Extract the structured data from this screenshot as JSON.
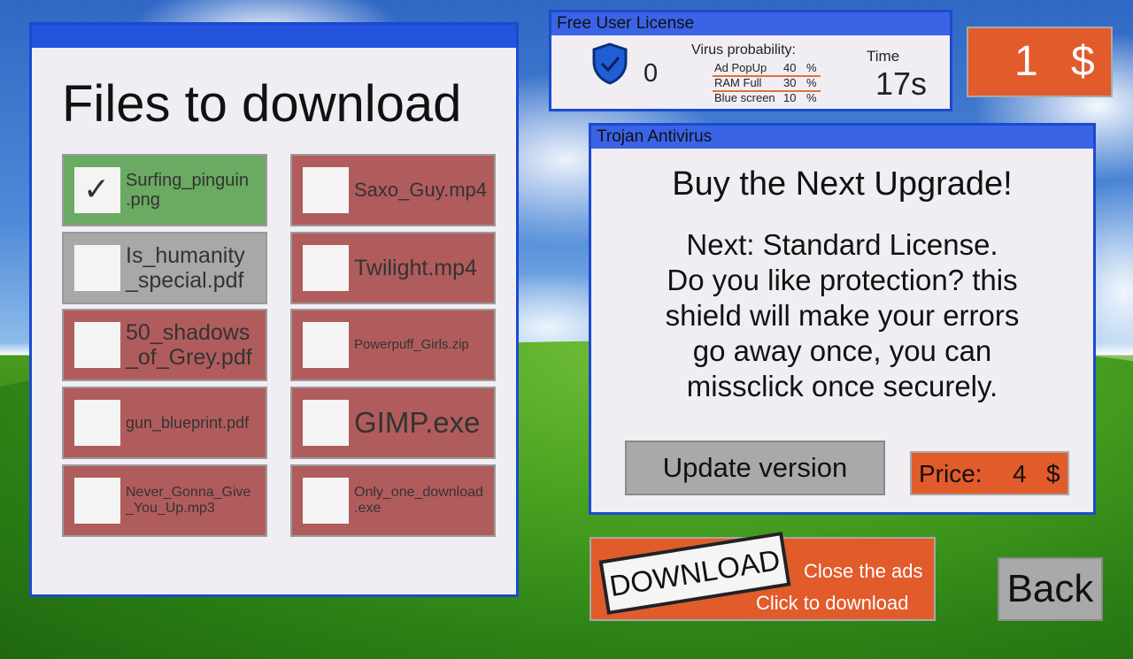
{
  "files_window": {
    "title": "Files to download",
    "files": [
      {
        "name": "Surfing_pinguin\n.png",
        "checked": true,
        "color": "#6aaa62"
      },
      {
        "name": "Saxo_Guy.mp4",
        "checked": false,
        "color": "#b15c5c"
      },
      {
        "name": "Is_humanity\n_special.pdf",
        "checked": false,
        "color": "#a8a8a8"
      },
      {
        "name": "Twilight.mp4",
        "checked": false,
        "color": "#b15c5c"
      },
      {
        "name": "50_shadows\n_of_Grey.pdf",
        "checked": false,
        "color": "#b15c5c"
      },
      {
        "name": "Powerpuff_Girls.zip",
        "checked": false,
        "color": "#b15c5c"
      },
      {
        "name": "gun_blueprint.pdf",
        "checked": false,
        "color": "#b15c5c"
      },
      {
        "name": "GIMP.exe",
        "checked": false,
        "color": "#b15c5c"
      },
      {
        "name": "Never_Gonna_Give\n_You_Up.mp3",
        "checked": false,
        "color": "#b15c5c"
      },
      {
        "name": "Only_one_download\n.exe",
        "checked": false,
        "color": "#b15c5c"
      }
    ],
    "check_mark": "✓"
  },
  "license": {
    "title": "Free User License",
    "shield_icon": "shield-check-icon",
    "shield_count": "0",
    "virus_title": "Virus probability:",
    "virus_rows": [
      {
        "label": "Ad PopUp",
        "value": "40",
        "unit": "%"
      },
      {
        "label": "RAM Full",
        "value": "30",
        "unit": "%"
      },
      {
        "label": "Blue screen",
        "value": "10",
        "unit": "%"
      }
    ],
    "time_label": "Time",
    "time_value": "17s"
  },
  "money": {
    "amount": "1",
    "currency": "$"
  },
  "antivirus": {
    "title": "Trojan Antivirus",
    "heading": "Buy the Next Upgrade!",
    "description": "Next: Standard License.\nDo you like protection? this\nshield will make your errors\ngo away once, you can\nmissclick once securely.",
    "update_button": "Update version",
    "price_label": "Price:",
    "price_value": "4",
    "price_currency": "$"
  },
  "download": {
    "badge": "DOWNLOAD",
    "close_text": "Close the ads",
    "click_text": "Click to download"
  },
  "back_button": "Back",
  "colors": {
    "accent_orange": "#e25b2b",
    "title_blue": "#2453dd",
    "file_red": "#b15c5c",
    "file_green": "#6aaa62",
    "file_gray": "#a8a8a8"
  }
}
